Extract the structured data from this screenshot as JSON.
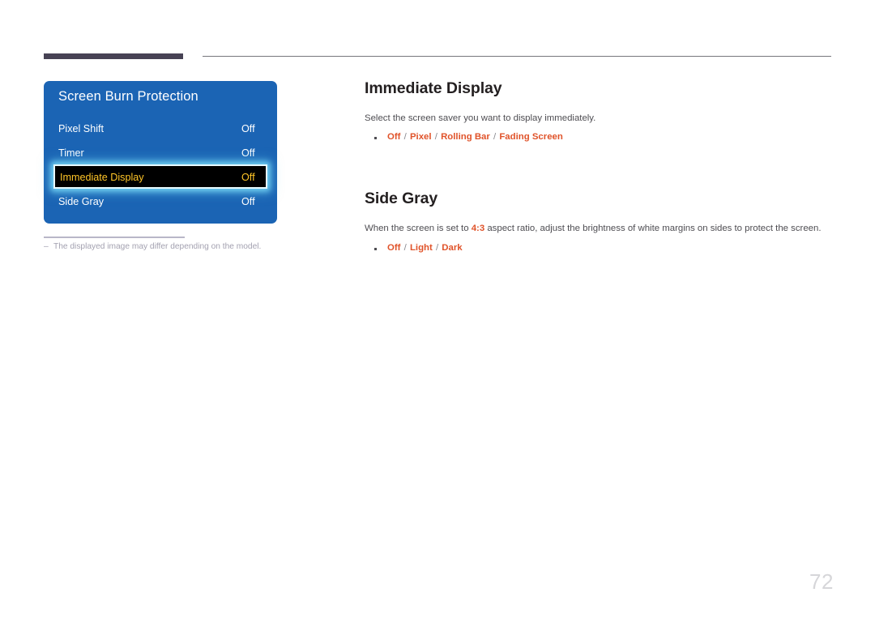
{
  "page": {
    "number": "72",
    "footnote": {
      "dash": "‒",
      "text": "The displayed image may differ depending on the model."
    }
  },
  "osd": {
    "title": "Screen Burn Protection",
    "rows": [
      {
        "label": "Pixel Shift",
        "value": "Off",
        "selected": false
      },
      {
        "label": "Timer",
        "value": "Off",
        "selected": false
      },
      {
        "label": "Immediate Display",
        "value": "Off",
        "selected": true
      },
      {
        "label": "Side Gray",
        "value": "Off",
        "selected": false
      }
    ],
    "colors": {
      "panel_blue": "#1b64b4",
      "selected_background": "#000000",
      "selected_text": "#ffc527",
      "selected_border": "#e8fbff"
    }
  },
  "sections": [
    {
      "heading": "Immediate Display",
      "description": "Select the screen saver you want to display immediately.",
      "options": [
        "Off",
        "Pixel",
        "Rolling Bar",
        "Fading Screen"
      ],
      "option_separator": "/"
    },
    {
      "heading": "Side Gray",
      "description_parts": [
        {
          "text": "When the screen is set to ",
          "accent": false
        },
        {
          "text": "4:3",
          "accent": true
        },
        {
          "text": " aspect ratio, adjust the brightness of white margins on sides to protect the screen.",
          "accent": false
        }
      ],
      "options": [
        "Off",
        "Light",
        "Dark"
      ],
      "option_separator": "/"
    }
  ],
  "colors": {
    "accent_orange": "#e0532a",
    "heading_dark": "#231f20",
    "body_gray": "#4e4d52",
    "rule_dark": "#474254",
    "rule_thin": "#77777c",
    "page_number_gray": "#d6d6d9"
  }
}
